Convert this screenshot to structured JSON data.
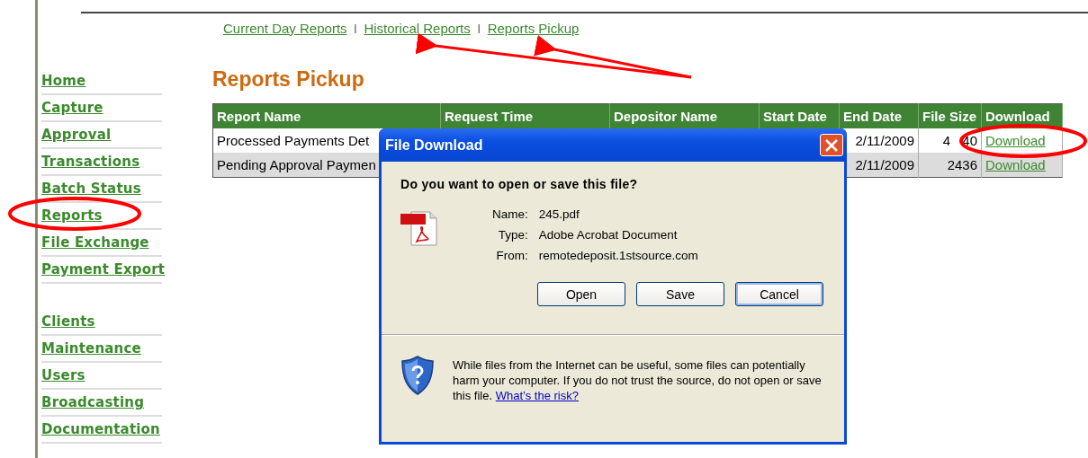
{
  "top_nav": [
    {
      "kind": "link",
      "text": "Current Day Reports"
    },
    {
      "kind": "separator",
      "text": "|"
    },
    {
      "kind": "link",
      "text": "Historical Reports"
    },
    {
      "kind": "separator",
      "text": "|"
    },
    {
      "kind": "link",
      "text": "Reports Pickup"
    }
  ],
  "sidebar": {
    "groups": [
      {
        "items": [
          "Home",
          "Capture",
          "Approval",
          "Transactions",
          "Batch Status",
          "Reports",
          "File Exchange",
          "Payment Export"
        ]
      },
      {
        "items": [
          "Clients",
          "Maintenance",
          "Users",
          "Broadcasting",
          "Documentation"
        ]
      }
    ]
  },
  "page_title": "Reports Pickup",
  "table": {
    "columns": [
      "Report Name",
      "Request Time",
      "Depositor Name",
      "Start Date",
      "End Date",
      "File Size",
      "Download"
    ],
    "rows": [
      {
        "report_name": "Processed Payments Det",
        "end_date": "2/11/2009",
        "file_size": "4 40",
        "download": "Download"
      },
      {
        "report_name": "Pending Approval Paymen",
        "end_date": "2/11/2009",
        "file_size": "2436",
        "download": "Download"
      }
    ]
  },
  "dialog": {
    "title": "File Download",
    "question": "Do you want to open or save this file?",
    "fields": [
      {
        "label": "Name:",
        "value": "245.pdf"
      },
      {
        "label": "Type:",
        "value": "Adobe Acrobat Document"
      },
      {
        "label": "From:",
        "value": "remotedeposit.1stsource.com"
      }
    ],
    "buttons": [
      {
        "label": "Open",
        "default": false
      },
      {
        "label": "Save",
        "default": false
      },
      {
        "label": "Cancel",
        "default": true
      }
    ],
    "warning": "While files from the Internet can be useful, some files can potentially harm your computer. If you do not trust the source, do not open or save this file.",
    "risk_link": "What’s the risk?"
  }
}
